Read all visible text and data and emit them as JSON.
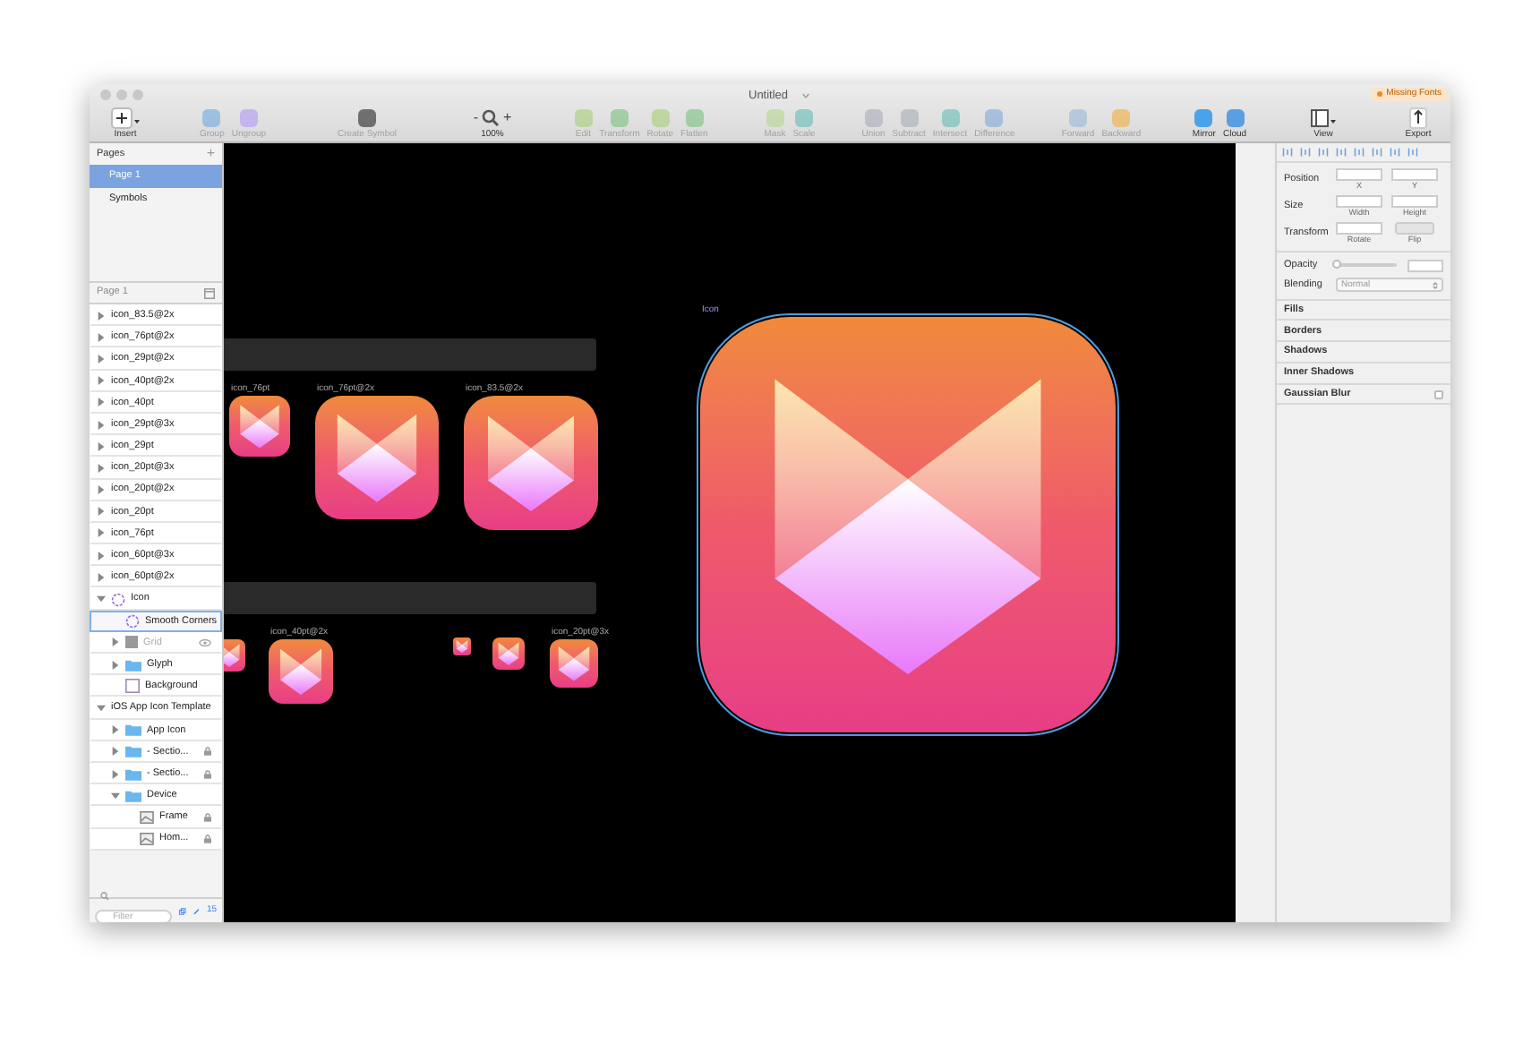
{
  "window": {
    "title": "Untitled",
    "badge": "Missing Fonts"
  },
  "toolbar": [
    {
      "tools": [
        {
          "label": "Insert",
          "kind": "insert",
          "disabled": false
        }
      ]
    },
    {
      "tools": [
        {
          "label": "Group",
          "kind": "button",
          "disabled": true
        },
        {
          "label": "Ungroup",
          "kind": "button",
          "disabled": true
        }
      ]
    },
    {
      "tools": [
        {
          "label": "Create Symbol",
          "kind": "button",
          "disabled": true
        }
      ]
    },
    {
      "tools": [
        {
          "label": "100%",
          "kind": "zoom",
          "minus": "-",
          "plus": "+",
          "disabled": false
        }
      ]
    },
    {
      "tools": [
        {
          "label": "Edit",
          "kind": "button",
          "disabled": true
        },
        {
          "label": "Transform",
          "kind": "button",
          "disabled": true
        },
        {
          "label": "Rotate",
          "kind": "button",
          "disabled": true
        },
        {
          "label": "Flatten",
          "kind": "button",
          "disabled": true
        }
      ]
    },
    {
      "tools": [
        {
          "label": "Mask",
          "kind": "button",
          "disabled": true
        },
        {
          "label": "Scale",
          "kind": "button",
          "disabled": true
        }
      ]
    },
    {
      "tools": [
        {
          "label": "Union",
          "kind": "button",
          "disabled": true
        },
        {
          "label": "Subtract",
          "kind": "button",
          "disabled": true
        },
        {
          "label": "Intersect",
          "kind": "button",
          "disabled": true
        },
        {
          "label": "Difference",
          "kind": "button",
          "disabled": true
        }
      ]
    },
    {
      "tools": [
        {
          "label": "Forward",
          "kind": "button",
          "disabled": true
        },
        {
          "label": "Backward",
          "kind": "button",
          "disabled": true
        }
      ]
    },
    {
      "tools": [
        {
          "label": "Mirror",
          "kind": "button",
          "disabled": false
        },
        {
          "label": "Cloud",
          "kind": "button",
          "disabled": false
        }
      ]
    },
    {
      "tools": [
        {
          "label": "View",
          "kind": "view",
          "disabled": false
        }
      ]
    },
    {
      "tools": [
        {
          "label": "Export",
          "kind": "export",
          "disabled": false
        }
      ]
    }
  ],
  "pages": {
    "title": "Pages",
    "add": "+",
    "items": [
      {
        "label": "Page 1",
        "selected": true
      },
      {
        "label": "Symbols",
        "selected": false
      }
    ]
  },
  "layers": {
    "title": "Page 1",
    "items": [
      {
        "name": "icon_83.5@2x",
        "kind": "artboard",
        "expanded": false,
        "locked": false,
        "hidden": false,
        "selected": false
      },
      {
        "name": "icon_76pt@2x",
        "kind": "artboard",
        "expanded": false,
        "locked": false,
        "hidden": false,
        "selected": false
      },
      {
        "name": "icon_29pt@2x",
        "kind": "artboard",
        "expanded": false,
        "locked": false,
        "hidden": false,
        "selected": false
      },
      {
        "name": "icon_40pt@2x",
        "kind": "artboard",
        "expanded": false,
        "locked": false,
        "hidden": false,
        "selected": false
      },
      {
        "name": "icon_40pt",
        "kind": "artboard",
        "expanded": false,
        "locked": false,
        "hidden": false,
        "selected": false
      },
      {
        "name": "icon_29pt@3x",
        "kind": "artboard",
        "expanded": false,
        "locked": false,
        "hidden": false,
        "selected": false
      },
      {
        "name": "icon_29pt",
        "kind": "artboard",
        "expanded": false,
        "locked": false,
        "hidden": false,
        "selected": false
      },
      {
        "name": "icon_20pt@3x",
        "kind": "artboard",
        "expanded": false,
        "locked": false,
        "hidden": false,
        "selected": false
      },
      {
        "name": "icon_20pt@2x",
        "kind": "artboard",
        "expanded": false,
        "locked": false,
        "hidden": false,
        "selected": false
      },
      {
        "name": "icon_20pt",
        "kind": "artboard",
        "expanded": false,
        "locked": false,
        "hidden": false,
        "selected": false
      },
      {
        "name": "icon_76pt",
        "kind": "artboard",
        "expanded": false,
        "locked": false,
        "hidden": false,
        "selected": false
      },
      {
        "name": "icon_60pt@3x",
        "kind": "artboard",
        "expanded": false,
        "locked": false,
        "hidden": false,
        "selected": false
      },
      {
        "name": "icon_60pt@2x",
        "kind": "artboard",
        "expanded": false,
        "locked": false,
        "hidden": false,
        "selected": false
      },
      {
        "name": "Icon",
        "kind": "symbol",
        "expanded": true,
        "locked": false,
        "hidden": false,
        "selected": false,
        "children": [
          {
            "name": "Smooth Corners",
            "kind": "symbol",
            "locked": false,
            "hidden": false,
            "selected": true
          },
          {
            "name": "Grid",
            "kind": "grid",
            "expanded": false,
            "locked": false,
            "hidden": true,
            "selected": false
          },
          {
            "name": "Glyph",
            "kind": "folder",
            "expanded": false,
            "locked": false,
            "hidden": false,
            "selected": false
          },
          {
            "name": "Background",
            "kind": "rect",
            "locked": false,
            "hidden": false,
            "selected": false
          }
        ]
      },
      {
        "name": "iOS App Icon Template",
        "kind": "page",
        "expanded": true,
        "locked": false,
        "hidden": false,
        "selected": false,
        "children": [
          {
            "name": "App Icon",
            "kind": "folder",
            "expanded": false,
            "locked": false,
            "hidden": false,
            "selected": false
          },
          {
            "name": "- Sectio...",
            "kind": "folder",
            "expanded": false,
            "locked": true,
            "hidden": false,
            "selected": false
          },
          {
            "name": "- Sectio...",
            "kind": "folder",
            "expanded": false,
            "locked": true,
            "hidden": false,
            "selected": false
          },
          {
            "name": "Device",
            "kind": "folder",
            "expanded": true,
            "locked": false,
            "hidden": false,
            "selected": false,
            "children": [
              {
                "name": "Frame",
                "kind": "image",
                "locked": true,
                "hidden": false,
                "selected": false
              },
              {
                "name": "Hom...",
                "kind": "image",
                "locked": true,
                "hidden": false,
                "selected": false
              }
            ]
          }
        ]
      }
    ],
    "filter": {
      "placeholder": "Filter"
    },
    "count": "15"
  },
  "canvas": {
    "artboards": [
      {
        "label": "icon_76pt",
        "selected": false
      },
      {
        "label": "icon_76pt@2x",
        "selected": false
      },
      {
        "label": "icon_83.5@2x",
        "selected": false
      },
      {
        "selected": false
      },
      {
        "label": "icon_40pt@2x",
        "selected": false
      },
      {
        "selected": false
      },
      {
        "selected": false
      },
      {
        "label": "icon_20pt@3x",
        "selected": false
      },
      {
        "label": "Icon",
        "selected": true
      }
    ]
  },
  "inspector": {
    "rows": [
      {
        "label": "Position",
        "kind": "pair",
        "fields": [
          "X",
          "Y"
        ]
      },
      {
        "label": "Size",
        "kind": "pair",
        "fields": [
          "Width",
          "Height"
        ]
      },
      {
        "label": "Transform",
        "kind": "transform",
        "fields": [
          "Rotate",
          "Flip"
        ]
      }
    ],
    "opacity": {
      "label": "Opacity",
      "level": 0
    },
    "blending": {
      "label": "Blending",
      "value": "Normal"
    },
    "sections": [
      {
        "label": "Fills"
      },
      {
        "label": "Borders"
      },
      {
        "label": "Shadows"
      },
      {
        "label": "Inner Shadows"
      },
      {
        "label": "Gaussian Blur",
        "checked": false
      }
    ]
  }
}
